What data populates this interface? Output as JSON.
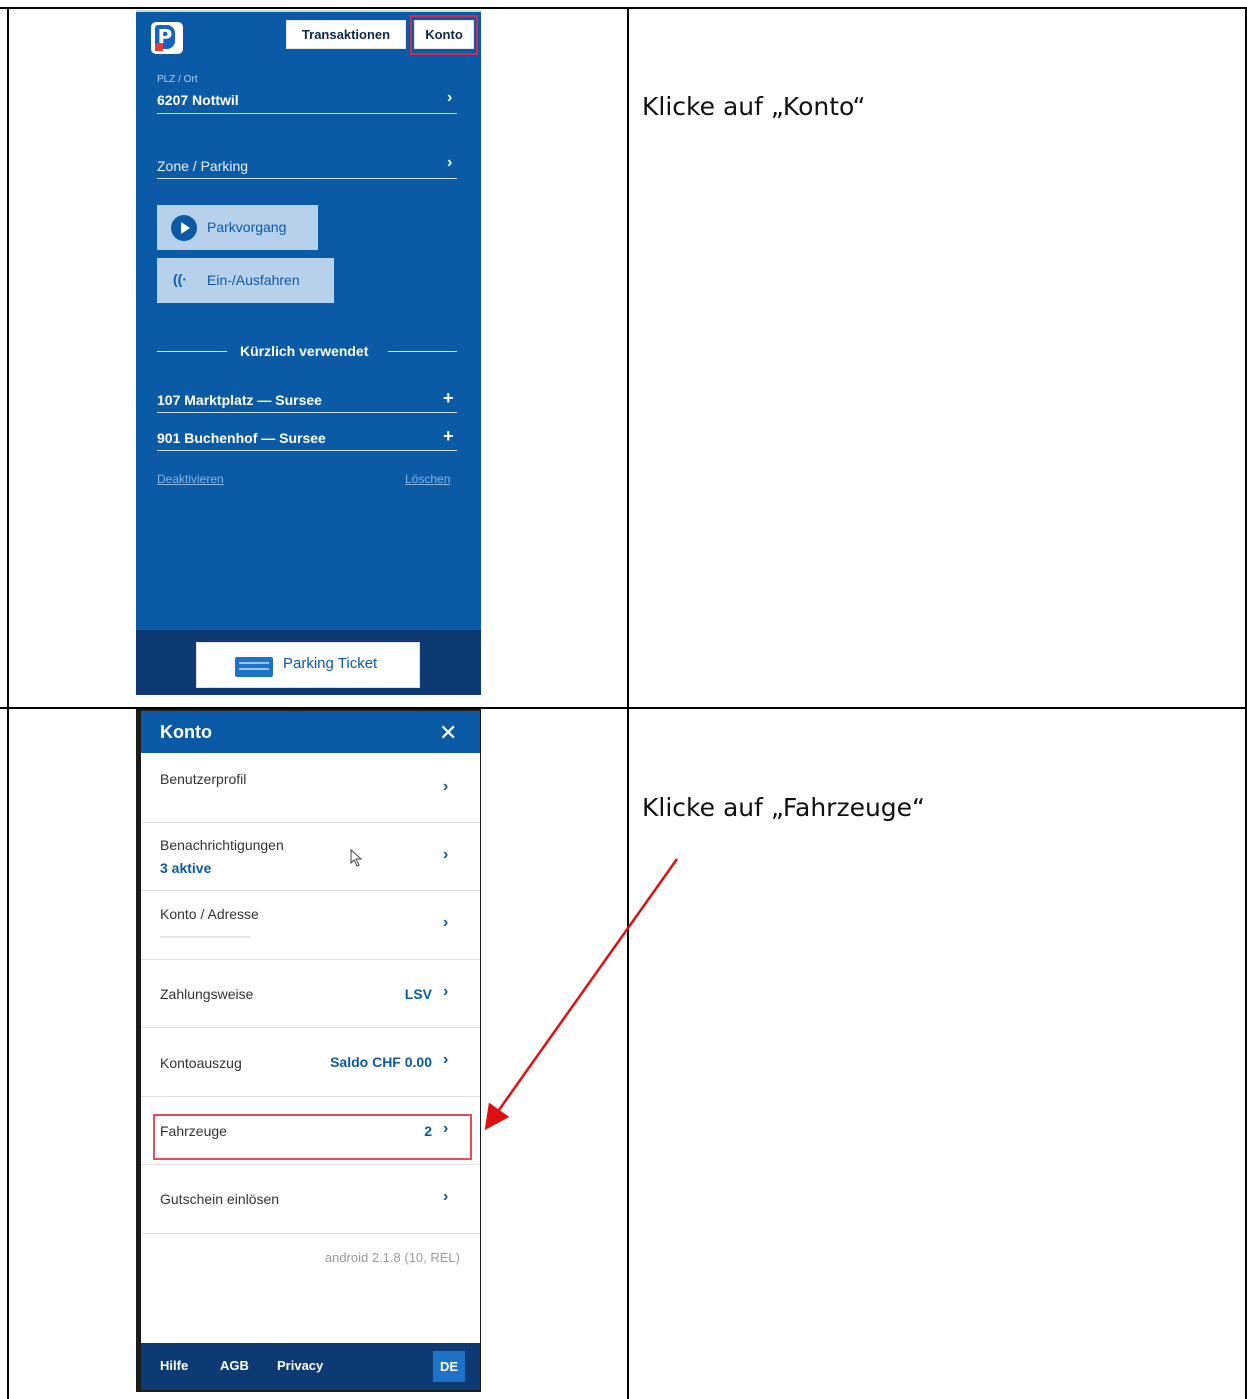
{
  "step1": {
    "instruction": "Klicke auf „Konto“",
    "tabs": {
      "transactions": "Transaktionen",
      "account": "Konto"
    },
    "location": {
      "label": "PLZ / Ort",
      "value": "6207 Nottwil"
    },
    "zone": {
      "label": "Zone / Parking"
    },
    "buttons": {
      "parking": "Parkvorgang",
      "entry_exit": "Ein-/Ausfahren"
    },
    "recent": {
      "title": "Kürzlich verwendet",
      "items": [
        "107 Marktplatz — Sursee",
        "901 Buchenhof — Sursee"
      ]
    },
    "links": {
      "deactivate": "Deaktivieren",
      "delete": "Löschen"
    },
    "ticket": "Parking Ticket",
    "colors": {
      "primary": "#0a5aa6",
      "highlight": "#d4294a"
    }
  },
  "step2": {
    "instruction": "Klicke auf „Fahrzeuge“",
    "title": "Konto",
    "rows": [
      {
        "label": "Benutzerprofil",
        "sub": "",
        "value": ""
      },
      {
        "label": "Benachrichtigungen",
        "sub": "3 aktive",
        "value": ""
      },
      {
        "label": "Konto / Adresse",
        "sub": "",
        "value": ""
      },
      {
        "label": "Zahlungsweise",
        "sub": "",
        "value": "LSV"
      },
      {
        "label": "Kontoauszug",
        "sub": "",
        "value": "Saldo CHF 0.00"
      },
      {
        "label": "Fahrzeuge",
        "sub": "",
        "value": "2"
      },
      {
        "label": "Gutschein einlösen",
        "sub": "",
        "value": ""
      }
    ],
    "version": "android 2.1.8 (10, REL)",
    "footer": {
      "help": "Hilfe",
      "terms": "AGB",
      "privacy": "Privacy",
      "language": "DE"
    },
    "arrow_color": "#e01010"
  }
}
